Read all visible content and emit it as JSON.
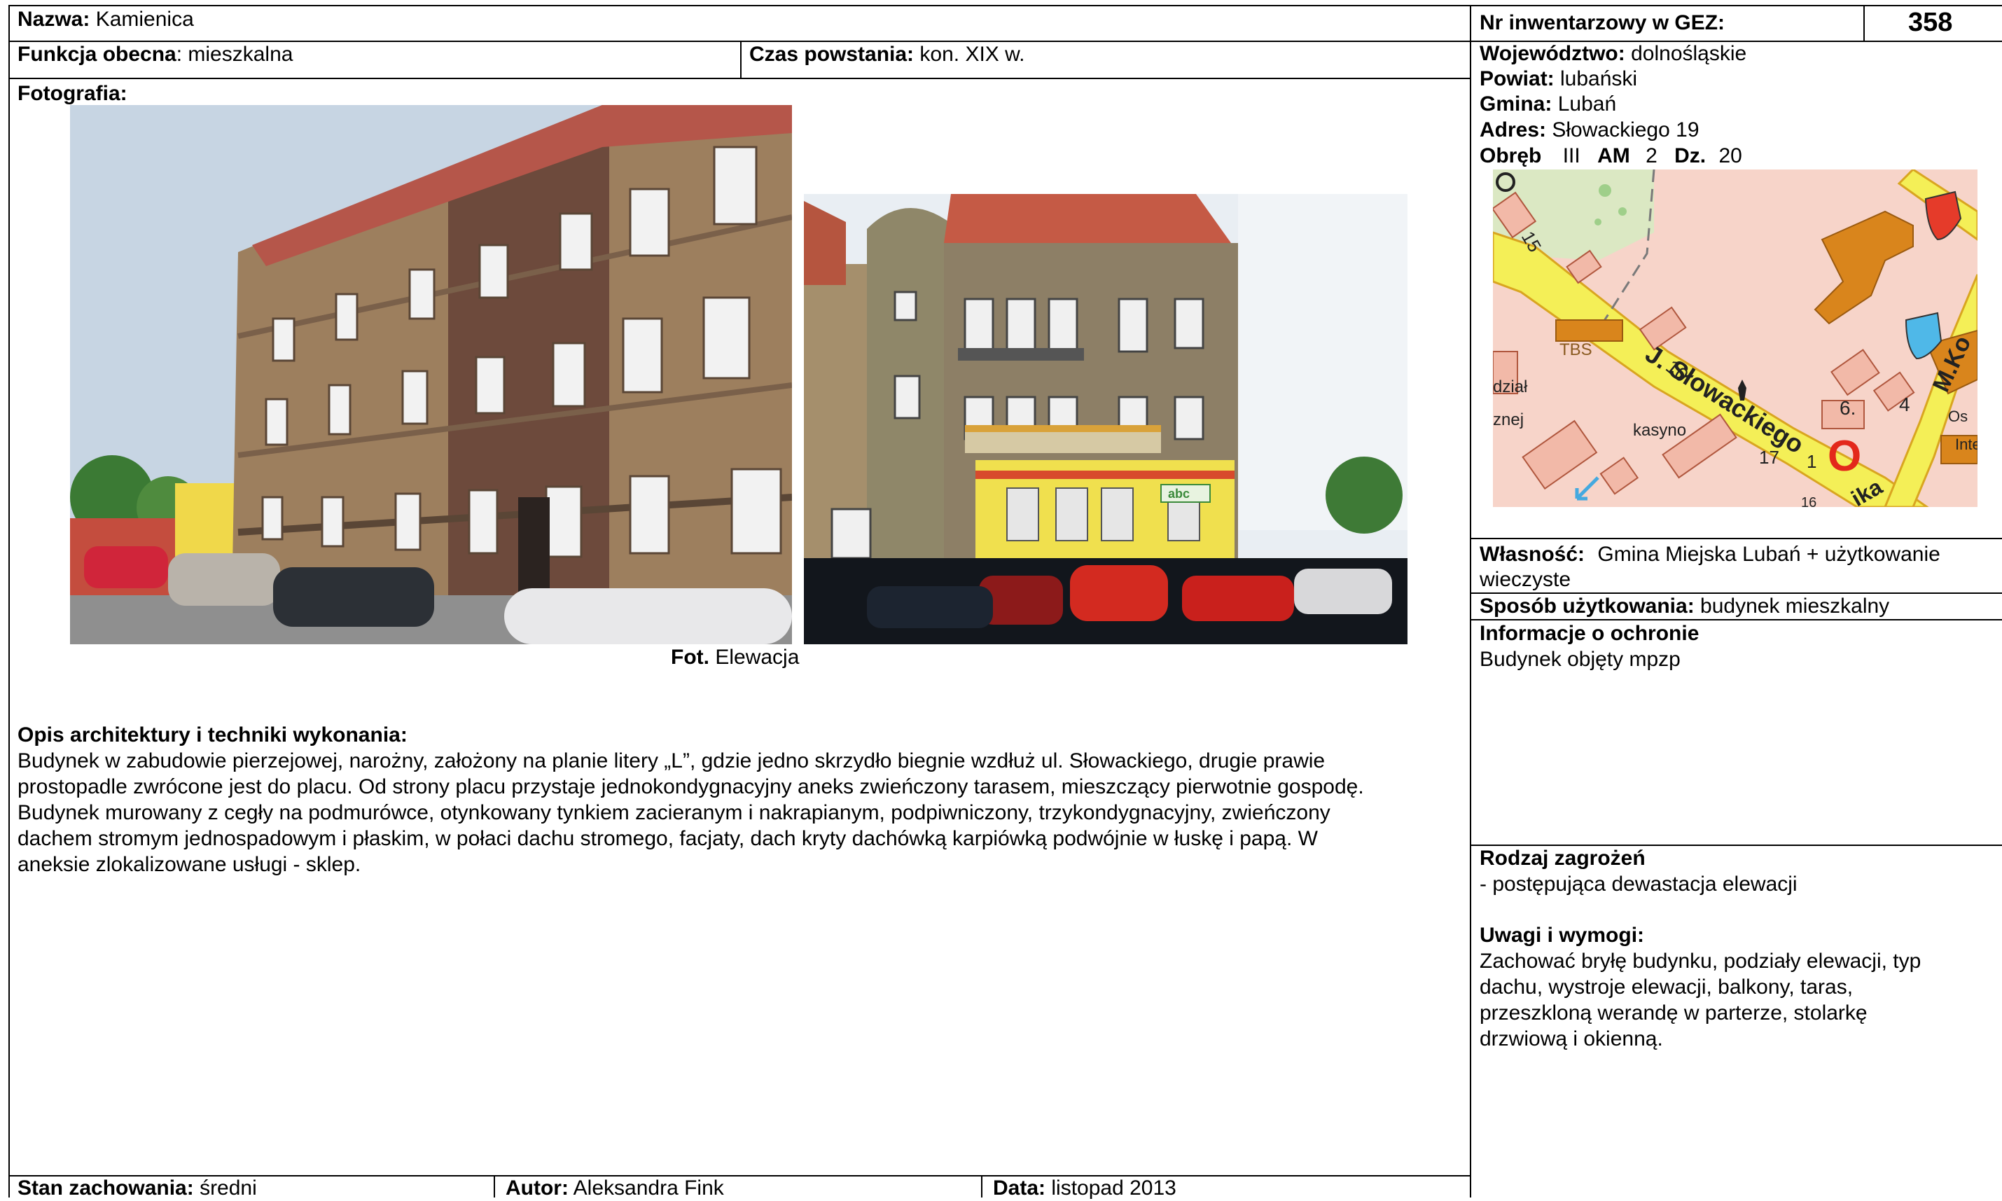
{
  "header": {
    "name_label": "Nazwa:",
    "name_value": "Kamienica",
    "inventory_label": "Nr inwentarzowy w GEZ:",
    "inventory_number": "358",
    "function_label": "Funkcja obecna",
    "function_value": ": mieszkalna",
    "date_label": "Czas powstania:",
    "date_value": "kon. XIX w."
  },
  "location": {
    "voivodeship_label": "Województwo:",
    "voivodeship_value": "dolnośląskie",
    "county_label": "Powiat:",
    "county_value": "lubański",
    "commune_label": "Gmina:",
    "commune_value": "Lubań",
    "address_label": "Adres:",
    "address_value": "Słowackiego 19",
    "obreb_label": "Obręb",
    "obreb_value": "III",
    "am_label": "AM",
    "am_value": "2",
    "dz_label": "Dz.",
    "dz_value": "20"
  },
  "map": {
    "labels": {
      "n15": "15",
      "tbs": "TBS",
      "n10": "10",
      "street": "J. Słowackiego",
      "kasyno": "kasyno",
      "n17": "17",
      "n1": "1",
      "n6": "6.",
      "n4": "4",
      "mk": "M.Ko",
      "dzial": "dział",
      "nej": "znej",
      "os": "Os",
      "inte": "Inte",
      "ika": "ika",
      "n16": "16"
    }
  },
  "photo": {
    "label": "Fotografia:",
    "caption_label": "Fot.",
    "caption_value": "Elewacja",
    "left_sign": "abc"
  },
  "description": {
    "title": "Opis architektury i techniki wykonania:",
    "lines": [
      "Budynek w zabudowie pierzejowej, narożny, założony na planie litery „L”, gdzie jedno skrzydło biegnie wzdłuż ul. Słowackiego, drugie prawie",
      "prostopadle zwrócone jest do placu. Od strony placu przystaje jednokondygnacyjny aneks zwieńczony tarasem, mieszczący pierwotnie gospodę.",
      "Budynek murowany z cegły na podmurówce, otynkowany tynkiem zacieranym i nakrapianym, podpiwniczony, trzykondygnacyjny, zwieńczony",
      "dachem stromym jednospadowym i płaskim, w połaci dachu stromego, facjaty, dach kryty dachówką karpiówką podwójnie w łuskę i papą. W",
      "aneksie zlokalizowane usługi - sklep."
    ]
  },
  "ownership": {
    "label": "Własność:",
    "value_line1": "Gmina Miejska Lubań + użytkowanie",
    "value_line2": "wieczyste"
  },
  "usage": {
    "label": "Sposób użytkowania:",
    "value": "budynek mieszkalny"
  },
  "protection": {
    "label": "Informacje o ochronie",
    "value": "Budynek objęty mpzp"
  },
  "threats": {
    "label": "Rodzaj zagrożeń",
    "value": "- postępująca dewastacja elewacji"
  },
  "remarks": {
    "label": "Uwagi i wymogi:",
    "lines": [
      "Zachować bryłę budynku, podziały elewacji, typ",
      "dachu, wystroje elewacji, balkony, taras,",
      "przeszkloną werandę w parterze, stolarkę",
      "drzwiową i okienną."
    ]
  },
  "footer": {
    "condition_label": "Stan zachowania:",
    "condition_value": "średni",
    "author_label": "Autor:",
    "author_value": "Aleksandra Fink",
    "date_label": "Data:",
    "date_value": "listopad 2013"
  }
}
